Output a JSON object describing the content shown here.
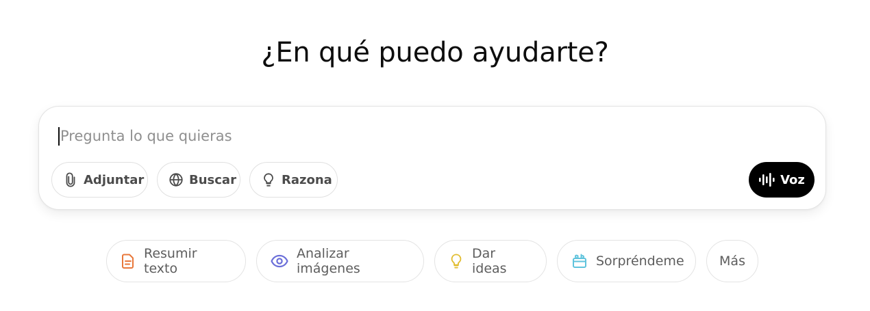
{
  "heading": "¿En qué puedo ayudarte?",
  "composer": {
    "placeholder": "Pregunta lo que quieras",
    "tools": [
      {
        "label": "Adjuntar",
        "icon": "paperclip-icon"
      },
      {
        "label": "Buscar",
        "icon": "globe-icon"
      },
      {
        "label": "Razona",
        "icon": "lightbulb-icon"
      }
    ],
    "voice": {
      "label": "Voz",
      "icon": "voice-waveform-icon"
    }
  },
  "suggestions": [
    {
      "label": "Resumir texto",
      "icon": "document-icon",
      "color": "#e8773a"
    },
    {
      "label": "Analizar imágenes",
      "icon": "eye-icon",
      "color": "#6b6fd9"
    },
    {
      "label": "Dar ideas",
      "icon": "lightbulb-icon",
      "color": "#e1bc2e"
    },
    {
      "label": "Sorpréndeme",
      "icon": "gift-icon",
      "color": "#5fc3dc"
    },
    {
      "label": "Más",
      "icon": "",
      "color": ""
    }
  ],
  "colors": {
    "text": "#0d0d0d",
    "placeholder": "#8f8f8f",
    "voice_button_bg": "#000000",
    "border": "#e3e3e3"
  }
}
